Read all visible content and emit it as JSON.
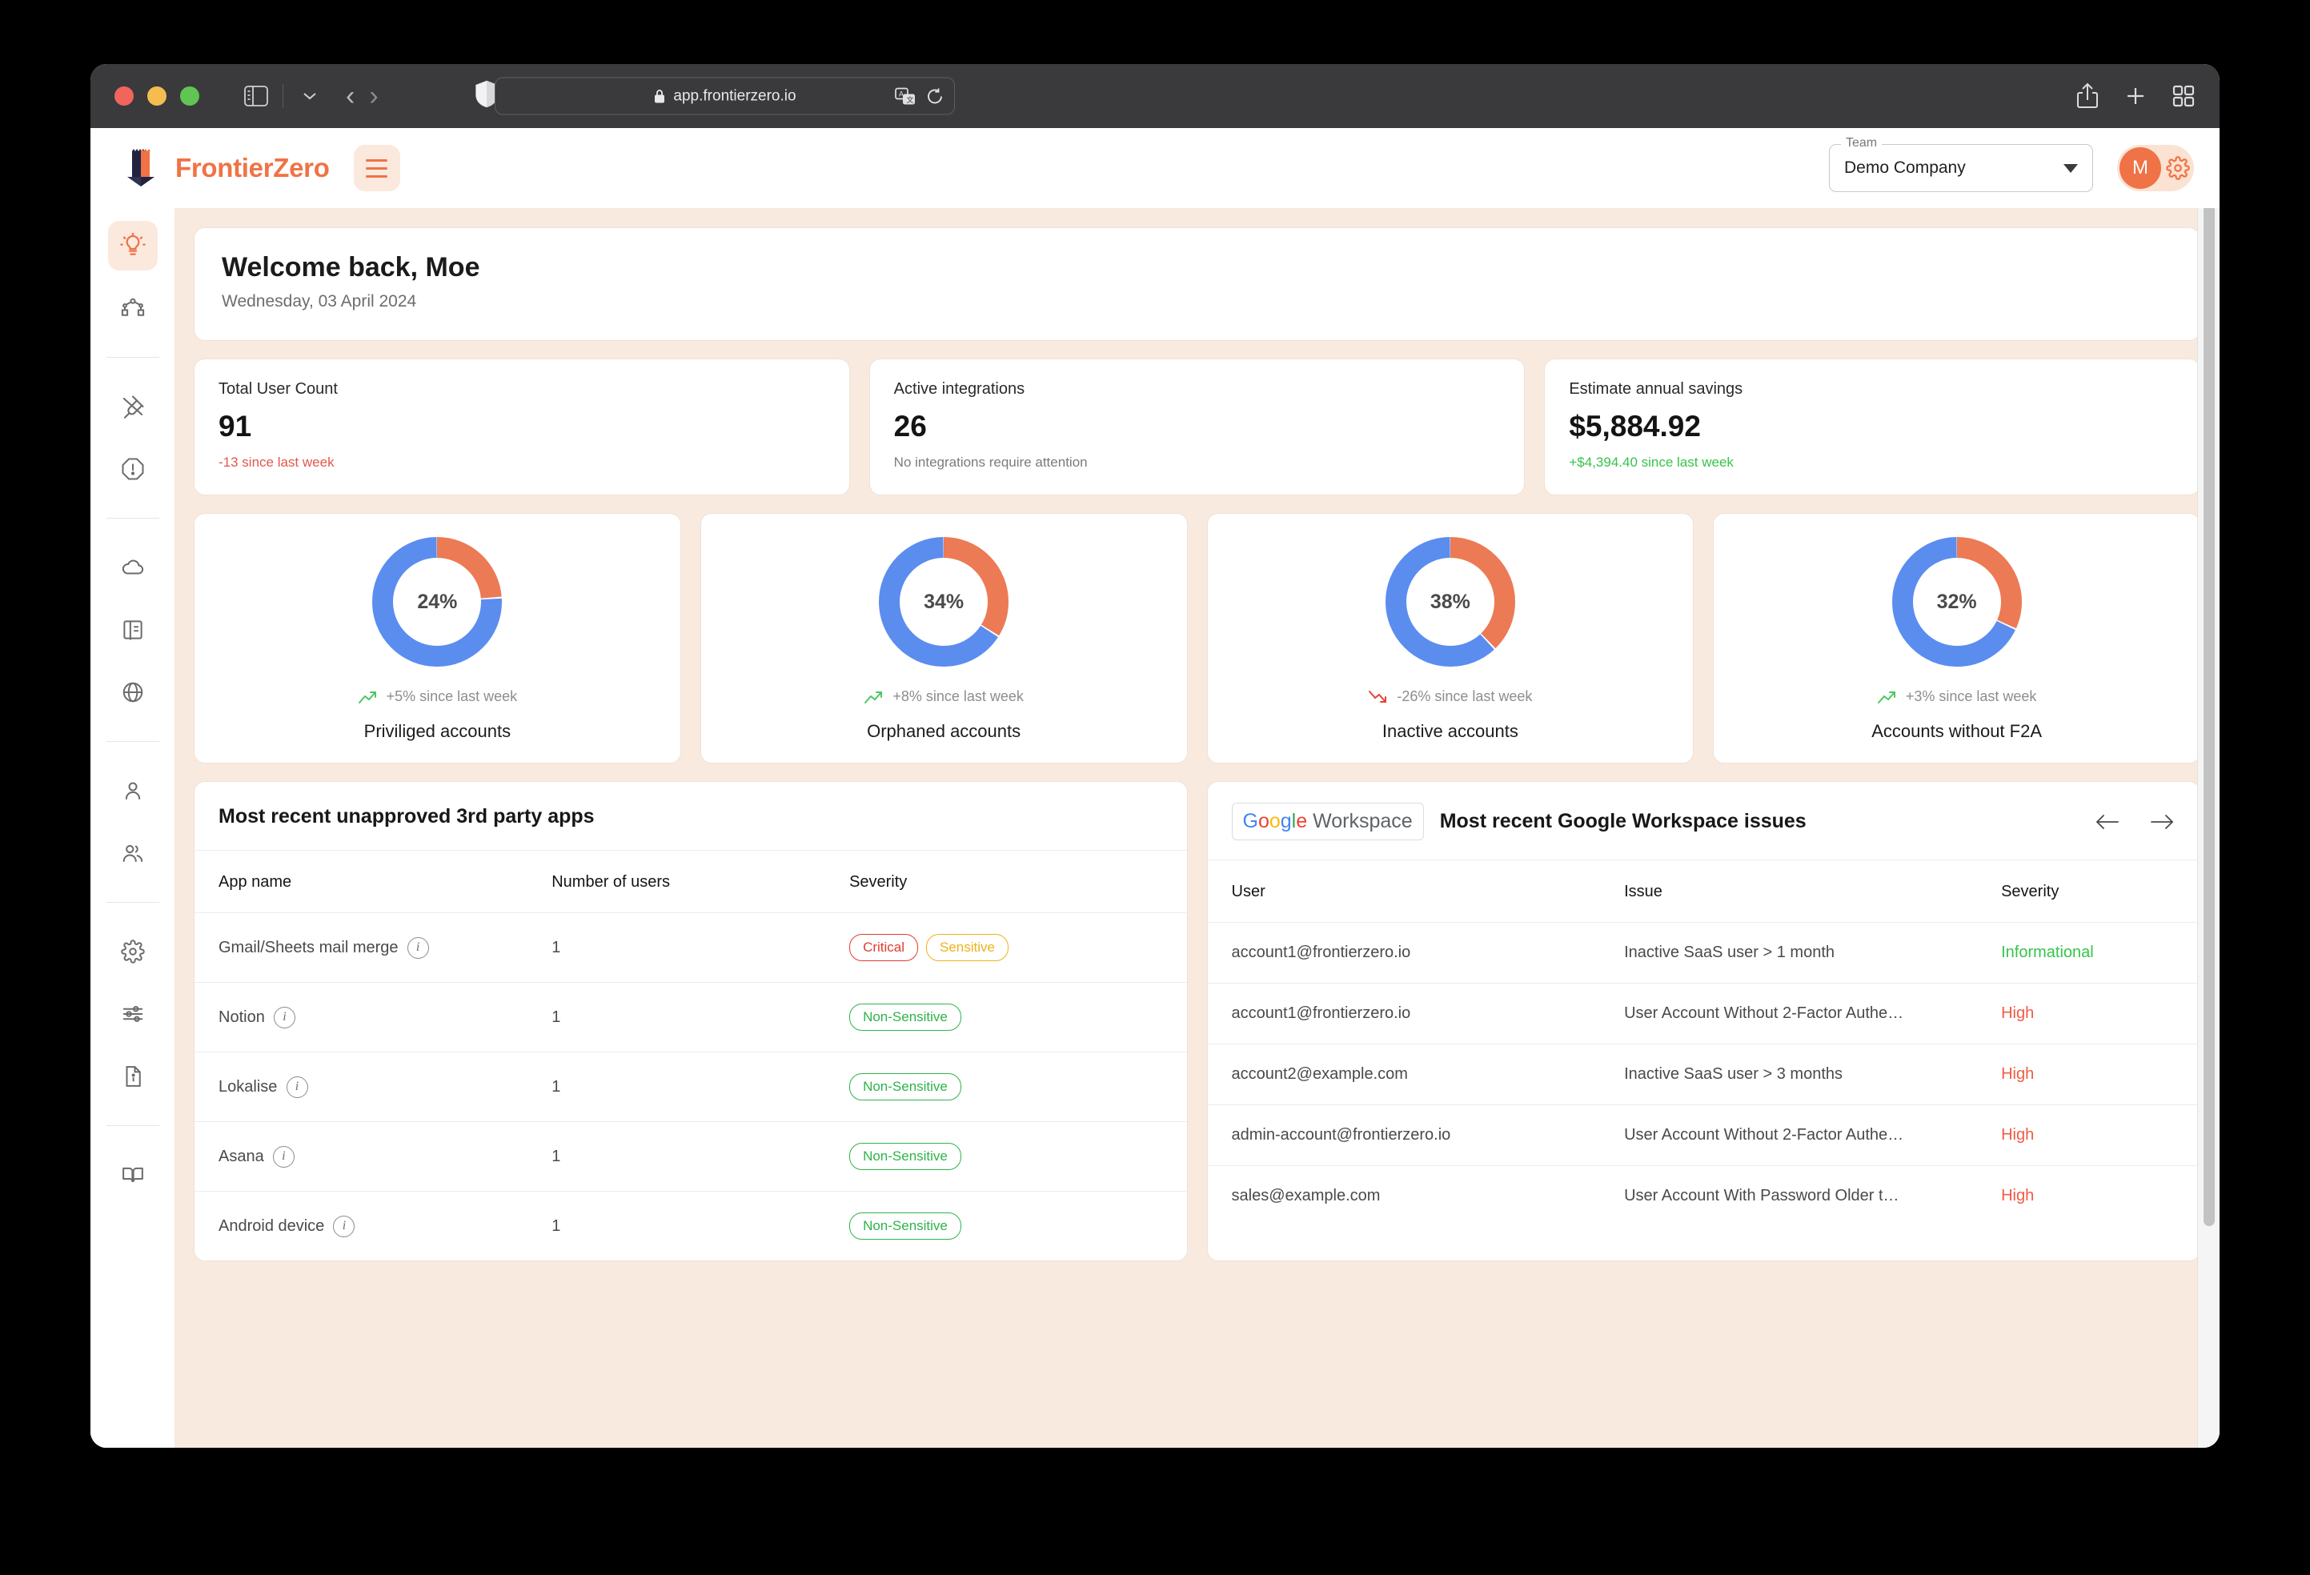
{
  "browser": {
    "url": "app.frontierzero.io",
    "lock_icon": "lock-icon",
    "sidebar_toggle_icon": "sidebar-toggle-icon",
    "back_icon": "back-arrow-icon",
    "forward_icon": "forward-arrow-icon",
    "shield_icon": "shield-icon",
    "translate_icon": "translate-icon",
    "reload_icon": "reload-icon",
    "share_icon": "share-icon",
    "new_tab_icon": "plus-icon",
    "tab_overview_icon": "tab-overview-icon"
  },
  "header": {
    "brand": "FrontierZero",
    "menu_icon": "hamburger-menu-icon",
    "team_legend": "Team",
    "team_value": "Demo Company",
    "avatar_initial": "M",
    "settings_icon": "gear-icon"
  },
  "sidebar": {
    "items": [
      {
        "name": "sidebar-item-insights",
        "icon": "lightbulb-icon",
        "active": true
      },
      {
        "name": "sidebar-item-graph",
        "icon": "node-graph-icon",
        "active": false
      },
      {
        "name": "sidebar-item-integrations",
        "icon": "plug-icon",
        "active": false
      },
      {
        "name": "sidebar-item-alerts",
        "icon": "alert-octagon-icon",
        "active": false
      },
      {
        "name": "sidebar-item-cloud",
        "icon": "cloud-icon",
        "active": false
      },
      {
        "name": "sidebar-item-reports",
        "icon": "book-panel-icon",
        "active": false
      },
      {
        "name": "sidebar-item-web",
        "icon": "globe-icon",
        "active": false
      },
      {
        "name": "sidebar-item-user",
        "icon": "user-icon",
        "active": false
      },
      {
        "name": "sidebar-item-users",
        "icon": "users-icon",
        "active": false
      },
      {
        "name": "sidebar-item-settings",
        "icon": "gear-icon",
        "active": false
      },
      {
        "name": "sidebar-item-preferences",
        "icon": "sliders-icon",
        "active": false
      },
      {
        "name": "sidebar-item-documents",
        "icon": "file-info-icon",
        "active": false
      },
      {
        "name": "sidebar-item-docs",
        "icon": "open-book-icon",
        "active": false
      }
    ]
  },
  "welcome": {
    "title": "Welcome back, Moe",
    "date": "Wednesday, 03 April 2024"
  },
  "stats": [
    {
      "label": "Total User Count",
      "value": "91",
      "sub": "-13 since last week",
      "tone": "neg"
    },
    {
      "label": "Active integrations",
      "value": "26",
      "sub": "No integrations require attention",
      "tone": "muted"
    },
    {
      "label": "Estimate annual savings",
      "value": "$5,884.92",
      "sub": "+$4,394.40 since last week",
      "tone": "pos"
    }
  ],
  "chart_data": [
    {
      "type": "pie",
      "title": "Priviliged accounts",
      "center_label": "24%",
      "delta": "+5% since last week",
      "delta_direction": "up",
      "series": [
        {
          "name": "Priviliged",
          "value": 24,
          "color": "#ec7a55"
        },
        {
          "name": "Other",
          "value": 76,
          "color": "#5b8def"
        }
      ]
    },
    {
      "type": "pie",
      "title": "Orphaned accounts",
      "center_label": "34%",
      "delta": "+8% since last week",
      "delta_direction": "up",
      "series": [
        {
          "name": "Orphaned",
          "value": 34,
          "color": "#ec7a55"
        },
        {
          "name": "Other",
          "value": 66,
          "color": "#5b8def"
        }
      ]
    },
    {
      "type": "pie",
      "title": "Inactive accounts",
      "center_label": "38%",
      "delta": "-26% since last week",
      "delta_direction": "down",
      "series": [
        {
          "name": "Inactive",
          "value": 38,
          "color": "#ec7a55"
        },
        {
          "name": "Other",
          "value": 62,
          "color": "#5b8def"
        }
      ]
    },
    {
      "type": "pie",
      "title": "Accounts without F2A",
      "center_label": "32%",
      "delta": "+3% since last week",
      "delta_direction": "up",
      "series": [
        {
          "name": "Without F2A",
          "value": 32,
          "color": "#ec7a55"
        },
        {
          "name": "Other",
          "value": 68,
          "color": "#5b8def"
        }
      ]
    }
  ],
  "apps_panel": {
    "title": "Most recent unapproved 3rd party apps",
    "columns": [
      "App name",
      "Number of users",
      "Severity"
    ],
    "rows": [
      {
        "app": "Gmail/Sheets mail merge",
        "info_icon": "info-icon",
        "users": "1",
        "badges": [
          {
            "label": "Critical",
            "tone": "critical"
          },
          {
            "label": "Sensitive",
            "tone": "sensitive"
          }
        ]
      },
      {
        "app": "Notion",
        "info_icon": "info-icon",
        "users": "1",
        "badges": [
          {
            "label": "Non-Sensitive",
            "tone": "nonsensitive"
          }
        ]
      },
      {
        "app": "Lokalise",
        "info_icon": "info-icon",
        "users": "1",
        "badges": [
          {
            "label": "Non-Sensitive",
            "tone": "nonsensitive"
          }
        ]
      },
      {
        "app": "Asana",
        "info_icon": "info-icon",
        "users": "1",
        "badges": [
          {
            "label": "Non-Sensitive",
            "tone": "nonsensitive"
          }
        ]
      },
      {
        "app": "Android device",
        "info_icon": "info-icon",
        "users": "1",
        "badges": [
          {
            "label": "Non-Sensitive",
            "tone": "nonsensitive"
          }
        ]
      }
    ]
  },
  "gw_panel": {
    "logo_text": "Google Workspace",
    "title": "Most recent Google Workspace issues",
    "prev_icon": "arrow-left-icon",
    "next_icon": "arrow-right-icon",
    "columns": [
      "User",
      "Issue",
      "Severity"
    ],
    "rows": [
      {
        "user": "account1@frontierzero.io",
        "issue": "Inactive SaaS user > 1 month",
        "severity": "Informational",
        "tone": "info"
      },
      {
        "user": "account1@frontierzero.io",
        "issue": "User Account Without 2-Factor Authe…",
        "severity": "High",
        "tone": "high"
      },
      {
        "user": "account2@example.com",
        "issue": "Inactive SaaS user > 3 months",
        "severity": "High",
        "tone": "high"
      },
      {
        "user": "admin-account@frontierzero.io",
        "issue": "User Account Without 2-Factor Authe…",
        "severity": "High",
        "tone": "high"
      },
      {
        "user": "sales@example.com",
        "issue": "User Account With Password Older t…",
        "severity": "High",
        "tone": "high"
      }
    ]
  }
}
